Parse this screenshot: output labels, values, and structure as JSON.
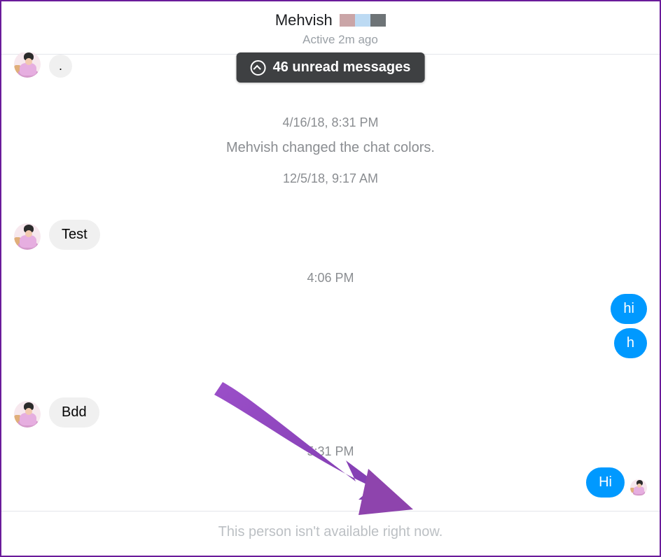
{
  "header": {
    "name": "Mehvish",
    "status": "Active 2m ago"
  },
  "unread_banner": "46 unread messages",
  "timestamps": {
    "t1": "4/16/18, 8:31 PM",
    "t2": "12/5/18, 9:17 AM",
    "t3": "4:06 PM",
    "t4": "5:31 PM"
  },
  "system_msg": "Mehvish changed the chat colors.",
  "messages": {
    "m0": ".",
    "m1": "Test",
    "m2": "hi",
    "m3": "h",
    "m4": "Bdd",
    "m5": "Hi"
  },
  "footer_text": "This person isn't available right now.",
  "colors": {
    "outgoing_bubble": "#0099ff",
    "incoming_bubble": "#f0f0f0",
    "annotation_arrow": "#8e44ad"
  }
}
